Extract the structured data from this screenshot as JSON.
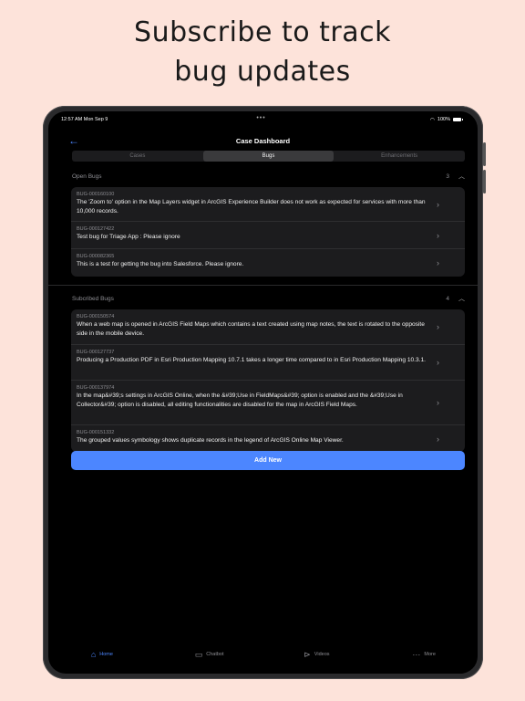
{
  "headline": {
    "line1": "Subscribe to track",
    "line2": "bug updates"
  },
  "status_bar": {
    "time": "12:57 AM   Mon Sep 9",
    "dots": "•••",
    "battery": "100%"
  },
  "nav": {
    "back_icon": "arrow-left-icon",
    "title": "Case Dashboard"
  },
  "segments": [
    {
      "label": "Cases",
      "active": false
    },
    {
      "label": "Bugs",
      "active": true
    },
    {
      "label": "Enhancements",
      "active": false
    }
  ],
  "open_bugs": {
    "title": "Open Bugs",
    "count": "3",
    "chevron": "^",
    "items": [
      {
        "id": "BUG-000160100",
        "text": "The 'Zoom to' option in the Map Layers widget in ArcGIS Experience Builder does not work as expected for services with more than 10,000 records."
      },
      {
        "id": "BUG-000127422",
        "text": "Test bug for Triage App : Please ignore"
      },
      {
        "id": "BUG-000082365",
        "text": "This is a test for getting the bug into Salesforce.  Please ignore."
      }
    ]
  },
  "subscribed_bugs": {
    "title": "Subcribed Bugs",
    "count": "4",
    "chevron": "^",
    "items": [
      {
        "id": "BUG-000150574",
        "text": "When a web map is opened in ArcGIS Field Maps which contains a text created using map notes, the text is rotated to the opposite side in the mobile device."
      },
      {
        "id": "BUG-000127737",
        "text": "Producing a Production PDF in Esri Production Mapping 10.7.1 takes a longer time compared to in Esri Production Mapping 10.3.1."
      },
      {
        "id": "BUG-000137974",
        "text": "In the map&#39;s settings in ArcGIS Online, when the &#39;Use in FieldMaps&#39; option is enabled and the &#39;Use in Collector&#39; option is disabled, all editing functionalities are disabled for the map in ArcGIS Field Maps."
      },
      {
        "id": "BUG-000151332",
        "text": "The grouped values symbology shows duplicate records in the legend of ArcGIS Online Map Viewer."
      }
    ]
  },
  "add_button": "Add New",
  "tabs": [
    {
      "label": "Home",
      "icon": "home-icon",
      "active": true
    },
    {
      "label": "Chatbot",
      "icon": "chat-icon",
      "active": false
    },
    {
      "label": "Videos",
      "icon": "video-icon",
      "active": false
    },
    {
      "label": "More",
      "icon": "more-icon",
      "active": false
    }
  ],
  "colors": {
    "accent": "#4c86ff",
    "background": "#fde3da",
    "screen": "#000000",
    "card": "#1c1c1e"
  }
}
